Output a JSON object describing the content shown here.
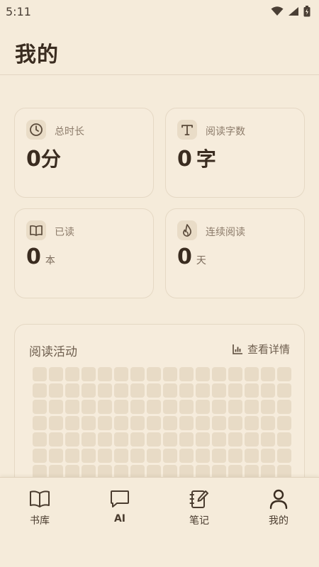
{
  "status_bar": {
    "time": "5:11"
  },
  "header": {
    "title": "我的"
  },
  "stats": [
    {
      "label": "总时长",
      "value": "0",
      "unit": "分",
      "icon": "clock-icon"
    },
    {
      "label": "阅读字数",
      "value": "0",
      "unit": "字",
      "icon": "text-t-icon"
    },
    {
      "label": "已读",
      "value": "0",
      "unit": "本",
      "icon": "book-icon"
    },
    {
      "label": "连续阅读",
      "value": "0",
      "unit": "天",
      "icon": "flame-icon"
    }
  ],
  "activity": {
    "title": "阅读活动",
    "details_label": "查看详情",
    "grid_columns": 16,
    "visible_rows": 7
  },
  "nav": [
    {
      "label": "书库",
      "icon": "book-open-icon"
    },
    {
      "label": "AI",
      "icon": "chat-bubble-icon"
    },
    {
      "label": "笔记",
      "icon": "notebook-pen-icon"
    },
    {
      "label": "我的",
      "icon": "user-icon"
    }
  ],
  "colors": {
    "background": "#f5ebda",
    "card": "#f6ecdc",
    "heat_cell": "#e8dbc6",
    "text_primary": "#3a2c20"
  }
}
